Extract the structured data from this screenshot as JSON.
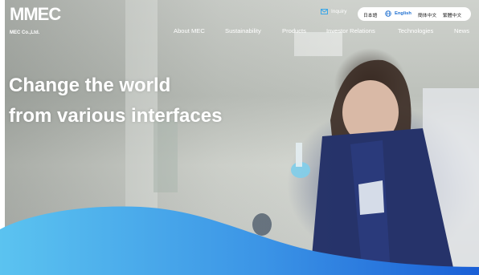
{
  "brand": {
    "logo_text": "MMEC",
    "company_name": "MEC Co.,Ltd."
  },
  "header": {
    "inquiry_label": "Inquiry",
    "languages": [
      {
        "label": "日本語",
        "active": false
      },
      {
        "label": "English",
        "active": true
      },
      {
        "label": "簡体中文",
        "active": false
      },
      {
        "label": "繁體中文",
        "active": false
      }
    ]
  },
  "nav": {
    "items": [
      "About MEC",
      "Sustainability",
      "Products",
      "Investor Relations",
      "Technologies",
      "News"
    ]
  },
  "hero": {
    "headline_line1": "Change the world",
    "headline_line2": "from various interfaces"
  },
  "colors": {
    "wave_light": "#5bc3f0",
    "wave_dark": "#1a5fd6",
    "accent": "#1e6fd0"
  }
}
